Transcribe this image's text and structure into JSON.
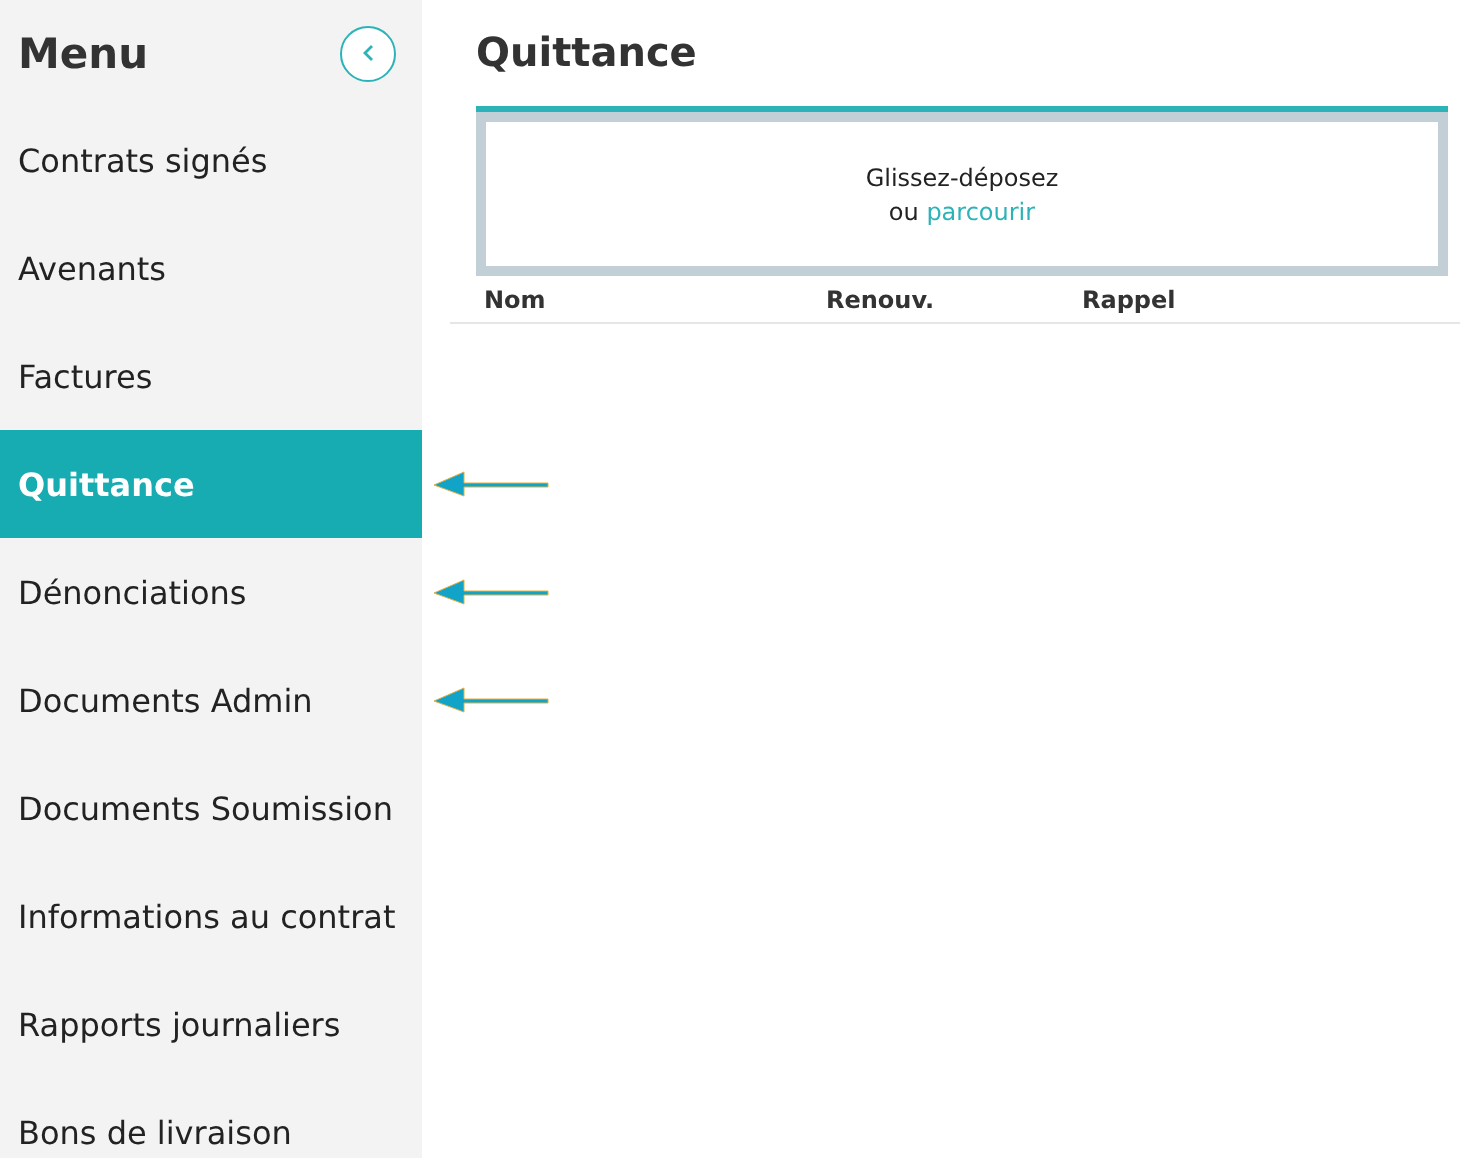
{
  "sidebar": {
    "title": "Menu",
    "items": [
      {
        "label": "Contrats signés",
        "selected": false,
        "arrow": false
      },
      {
        "label": "Avenants",
        "selected": false,
        "arrow": false
      },
      {
        "label": "Factures",
        "selected": false,
        "arrow": false
      },
      {
        "label": "Quittance",
        "selected": true,
        "arrow": true
      },
      {
        "label": "Dénonciations",
        "selected": false,
        "arrow": true
      },
      {
        "label": "Documents Admin",
        "selected": false,
        "arrow": true
      },
      {
        "label": "Documents Soumission",
        "selected": false,
        "arrow": false
      },
      {
        "label": "Informations au contrat",
        "selected": false,
        "arrow": false
      },
      {
        "label": "Rapports journaliers",
        "selected": false,
        "arrow": false
      },
      {
        "label": "Bons de livraison",
        "selected": false,
        "arrow": false
      }
    ]
  },
  "page": {
    "title": "Quittance"
  },
  "dropzone": {
    "text": "Glissez-déposez",
    "prefix": "ou",
    "link": "parcourir"
  },
  "table": {
    "columns": [
      "Nom",
      "Renouv.",
      "Rappel"
    ]
  }
}
